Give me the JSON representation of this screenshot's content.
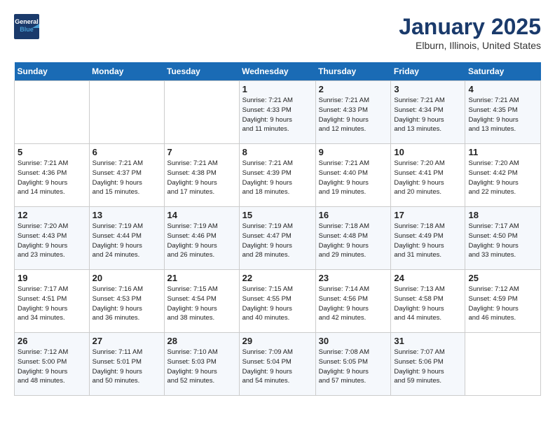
{
  "header": {
    "logo_line1": "General",
    "logo_line2": "Blue",
    "title": "January 2025",
    "subtitle": "Elburn, Illinois, United States"
  },
  "days_of_week": [
    "Sunday",
    "Monday",
    "Tuesday",
    "Wednesday",
    "Thursday",
    "Friday",
    "Saturday"
  ],
  "weeks": [
    [
      {
        "day": "",
        "detail": ""
      },
      {
        "day": "",
        "detail": ""
      },
      {
        "day": "",
        "detail": ""
      },
      {
        "day": "1",
        "detail": "Sunrise: 7:21 AM\nSunset: 4:33 PM\nDaylight: 9 hours\nand 11 minutes."
      },
      {
        "day": "2",
        "detail": "Sunrise: 7:21 AM\nSunset: 4:33 PM\nDaylight: 9 hours\nand 12 minutes."
      },
      {
        "day": "3",
        "detail": "Sunrise: 7:21 AM\nSunset: 4:34 PM\nDaylight: 9 hours\nand 13 minutes."
      },
      {
        "day": "4",
        "detail": "Sunrise: 7:21 AM\nSunset: 4:35 PM\nDaylight: 9 hours\nand 13 minutes."
      }
    ],
    [
      {
        "day": "5",
        "detail": "Sunrise: 7:21 AM\nSunset: 4:36 PM\nDaylight: 9 hours\nand 14 minutes."
      },
      {
        "day": "6",
        "detail": "Sunrise: 7:21 AM\nSunset: 4:37 PM\nDaylight: 9 hours\nand 15 minutes."
      },
      {
        "day": "7",
        "detail": "Sunrise: 7:21 AM\nSunset: 4:38 PM\nDaylight: 9 hours\nand 17 minutes."
      },
      {
        "day": "8",
        "detail": "Sunrise: 7:21 AM\nSunset: 4:39 PM\nDaylight: 9 hours\nand 18 minutes."
      },
      {
        "day": "9",
        "detail": "Sunrise: 7:21 AM\nSunset: 4:40 PM\nDaylight: 9 hours\nand 19 minutes."
      },
      {
        "day": "10",
        "detail": "Sunrise: 7:20 AM\nSunset: 4:41 PM\nDaylight: 9 hours\nand 20 minutes."
      },
      {
        "day": "11",
        "detail": "Sunrise: 7:20 AM\nSunset: 4:42 PM\nDaylight: 9 hours\nand 22 minutes."
      }
    ],
    [
      {
        "day": "12",
        "detail": "Sunrise: 7:20 AM\nSunset: 4:43 PM\nDaylight: 9 hours\nand 23 minutes."
      },
      {
        "day": "13",
        "detail": "Sunrise: 7:19 AM\nSunset: 4:44 PM\nDaylight: 9 hours\nand 24 minutes."
      },
      {
        "day": "14",
        "detail": "Sunrise: 7:19 AM\nSunset: 4:46 PM\nDaylight: 9 hours\nand 26 minutes."
      },
      {
        "day": "15",
        "detail": "Sunrise: 7:19 AM\nSunset: 4:47 PM\nDaylight: 9 hours\nand 28 minutes."
      },
      {
        "day": "16",
        "detail": "Sunrise: 7:18 AM\nSunset: 4:48 PM\nDaylight: 9 hours\nand 29 minutes."
      },
      {
        "day": "17",
        "detail": "Sunrise: 7:18 AM\nSunset: 4:49 PM\nDaylight: 9 hours\nand 31 minutes."
      },
      {
        "day": "18",
        "detail": "Sunrise: 7:17 AM\nSunset: 4:50 PM\nDaylight: 9 hours\nand 33 minutes."
      }
    ],
    [
      {
        "day": "19",
        "detail": "Sunrise: 7:17 AM\nSunset: 4:51 PM\nDaylight: 9 hours\nand 34 minutes."
      },
      {
        "day": "20",
        "detail": "Sunrise: 7:16 AM\nSunset: 4:53 PM\nDaylight: 9 hours\nand 36 minutes."
      },
      {
        "day": "21",
        "detail": "Sunrise: 7:15 AM\nSunset: 4:54 PM\nDaylight: 9 hours\nand 38 minutes."
      },
      {
        "day": "22",
        "detail": "Sunrise: 7:15 AM\nSunset: 4:55 PM\nDaylight: 9 hours\nand 40 minutes."
      },
      {
        "day": "23",
        "detail": "Sunrise: 7:14 AM\nSunset: 4:56 PM\nDaylight: 9 hours\nand 42 minutes."
      },
      {
        "day": "24",
        "detail": "Sunrise: 7:13 AM\nSunset: 4:58 PM\nDaylight: 9 hours\nand 44 minutes."
      },
      {
        "day": "25",
        "detail": "Sunrise: 7:12 AM\nSunset: 4:59 PM\nDaylight: 9 hours\nand 46 minutes."
      }
    ],
    [
      {
        "day": "26",
        "detail": "Sunrise: 7:12 AM\nSunset: 5:00 PM\nDaylight: 9 hours\nand 48 minutes."
      },
      {
        "day": "27",
        "detail": "Sunrise: 7:11 AM\nSunset: 5:01 PM\nDaylight: 9 hours\nand 50 minutes."
      },
      {
        "day": "28",
        "detail": "Sunrise: 7:10 AM\nSunset: 5:03 PM\nDaylight: 9 hours\nand 52 minutes."
      },
      {
        "day": "29",
        "detail": "Sunrise: 7:09 AM\nSunset: 5:04 PM\nDaylight: 9 hours\nand 54 minutes."
      },
      {
        "day": "30",
        "detail": "Sunrise: 7:08 AM\nSunset: 5:05 PM\nDaylight: 9 hours\nand 57 minutes."
      },
      {
        "day": "31",
        "detail": "Sunrise: 7:07 AM\nSunset: 5:06 PM\nDaylight: 9 hours\nand 59 minutes."
      },
      {
        "day": "",
        "detail": ""
      }
    ]
  ]
}
